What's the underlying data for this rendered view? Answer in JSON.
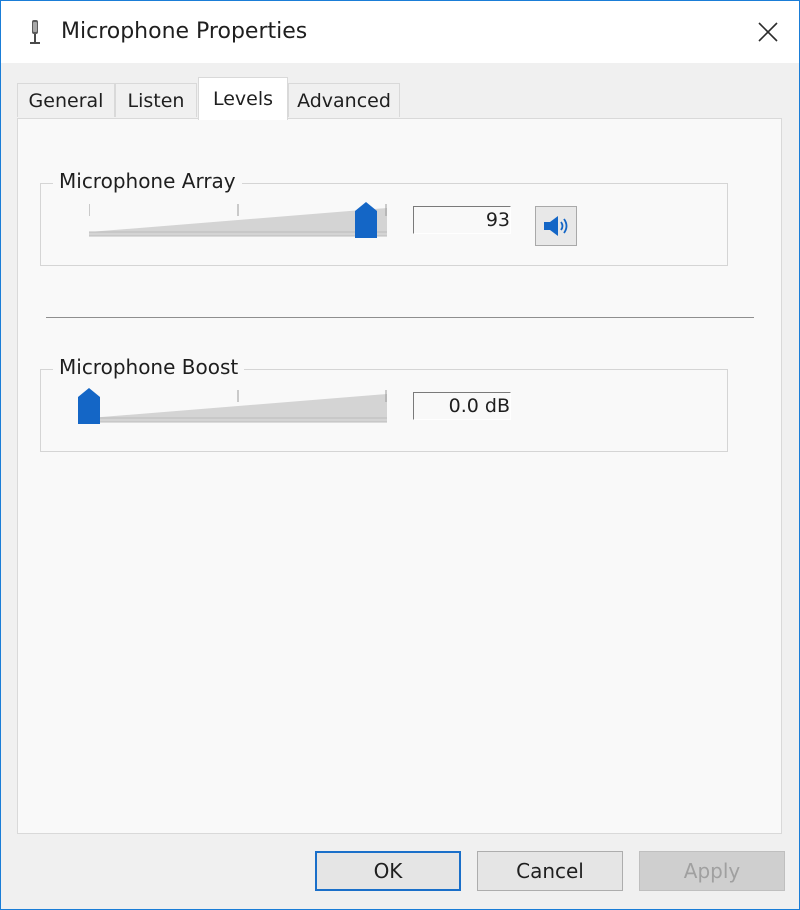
{
  "window": {
    "title": "Microphone Properties"
  },
  "tabs": [
    {
      "label": "General",
      "active": false
    },
    {
      "label": "Listen",
      "active": false
    },
    {
      "label": "Levels",
      "active": true
    },
    {
      "label": "Advanced",
      "active": false
    }
  ],
  "levels": {
    "microphone_array": {
      "label": "Microphone Array",
      "value": "93",
      "slider_fraction": 0.93
    },
    "microphone_boost": {
      "label": "Microphone Boost",
      "value": "0.0 dB",
      "slider_fraction": 0.0
    },
    "speaker_icon": "speaker-volume-icon"
  },
  "buttons": {
    "ok": "OK",
    "cancel": "Cancel",
    "apply": "Apply"
  },
  "colors": {
    "accent": "#1a6fc9",
    "thumb": "#1466c6",
    "window_border": "#1a7dd7"
  }
}
